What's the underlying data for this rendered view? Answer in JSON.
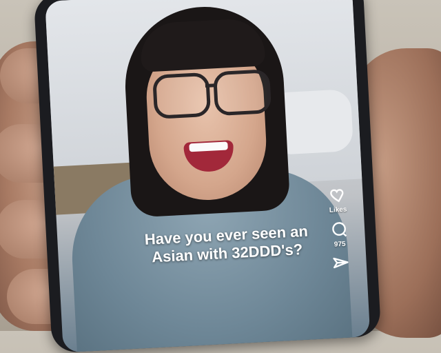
{
  "video": {
    "caption_line1": "Have you ever seen an",
    "caption_line2": "Asian with 32DDD's?"
  },
  "actions": {
    "like": {
      "icon": "heart-icon",
      "label": "Likes"
    },
    "comment": {
      "icon": "comment-icon",
      "count": "975"
    },
    "share": {
      "icon": "share-icon"
    }
  },
  "colors": {
    "overlay_text": "#ffffff"
  }
}
